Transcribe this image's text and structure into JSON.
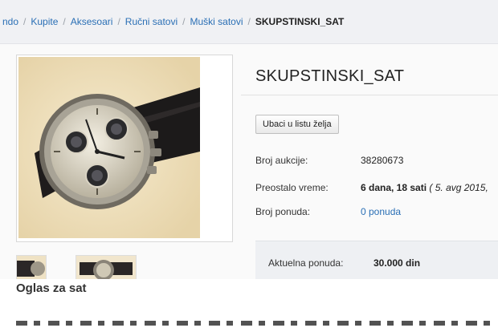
{
  "breadcrumb": {
    "items": [
      {
        "label": "ndo"
      },
      {
        "label": "Kupite"
      },
      {
        "label": "Aksesoari"
      },
      {
        "label": "Ručni satovi"
      },
      {
        "label": "Muški satovi"
      }
    ],
    "separator": "/",
    "current": "SKUPSTINSKI_SAT"
  },
  "product": {
    "title": "SKUPSTINSKI_SAT",
    "image_icon": "wristwatch-photo",
    "wishlist_label": "Ubaci u listu želja"
  },
  "details": {
    "auction_label": "Broj aukcije:",
    "auction_value": "38280673",
    "time_label": "Preostalo vreme:",
    "time_value": "6 dana, 18 sati",
    "time_extra": "( 5. avg 2015,",
    "bids_label": "Broj ponuda:",
    "bids_value": "0 ponuda"
  },
  "bid": {
    "label": "Aktuelna ponuda:",
    "value": "30.000 din"
  },
  "caption": "Oglas za sat",
  "colors": {
    "link": "#2a6fb5",
    "breadcrumb_bg": "#f0f1f4",
    "bid_panel_bg": "#eef0f3"
  }
}
